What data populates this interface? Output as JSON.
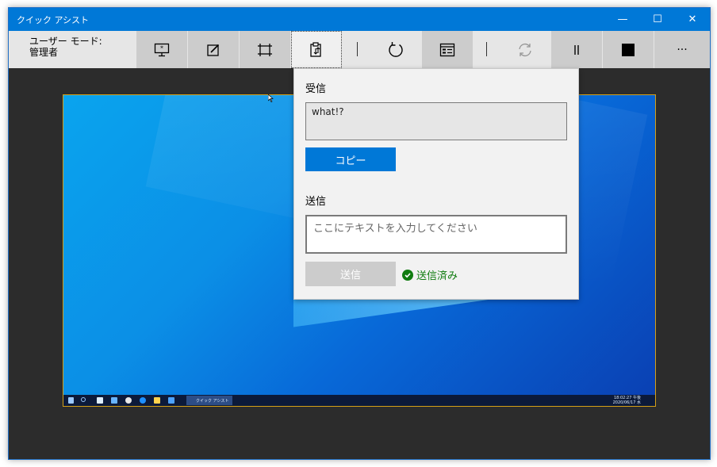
{
  "window": {
    "title": "クイック アシスト",
    "minimize_label": "—",
    "maximize_label": "☐",
    "close_label": "✕"
  },
  "toolbar": {
    "mode_line1": "ユーザー モード:",
    "mode_line2": "管理者",
    "buttons": [
      {
        "icon": "select-monitor-icon"
      },
      {
        "icon": "annotate-icon"
      },
      {
        "icon": "actual-size-icon"
      },
      {
        "icon": "clipboard-icon"
      },
      {
        "icon": "restart-icon"
      },
      {
        "icon": "task-manager-icon"
      },
      {
        "icon": "reconnect-icon"
      },
      {
        "icon": "pause-icon"
      },
      {
        "icon": "stop-icon"
      },
      {
        "icon": "more-icon",
        "label": "···"
      }
    ]
  },
  "panel": {
    "receive_label": "受信",
    "received_text": "what!?",
    "copy_label": "コピー",
    "send_label": "送信",
    "send_placeholder": "ここにテキストを入力してください",
    "send_button_label": "送信",
    "status_text": "送信済み"
  },
  "remote_desktop": {
    "taskbar_app_label": "クイック アシスト",
    "clock_time": "18:02:27 午後",
    "clock_date": "2020/06/17 水"
  },
  "colors": {
    "accent": "#0078d7",
    "success": "#107c10",
    "titlebar": "#0078d7"
  }
}
